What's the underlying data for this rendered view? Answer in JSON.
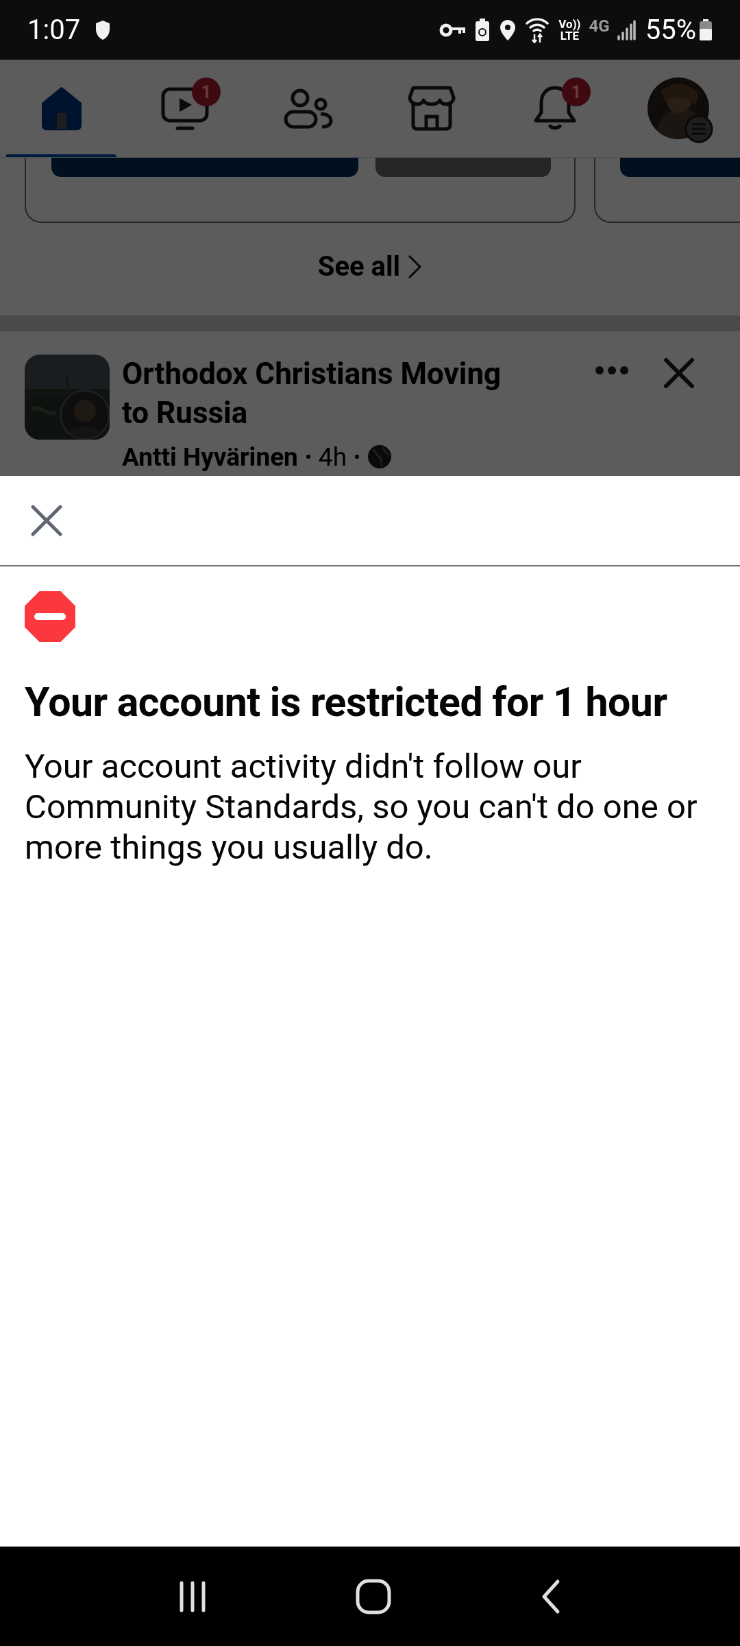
{
  "status_bar": {
    "time": "1:07",
    "volte": [
      "Vo))",
      "LTE"
    ],
    "network": "4G",
    "battery": "55%"
  },
  "tabs": [
    {
      "kind": "home",
      "selected": true
    },
    {
      "kind": "video",
      "selected": false,
      "badge": "1"
    },
    {
      "kind": "friends",
      "selected": false
    },
    {
      "kind": "marketplace",
      "selected": false
    },
    {
      "kind": "notifications",
      "selected": false,
      "badge": "1"
    },
    {
      "kind": "profile",
      "selected": false
    }
  ],
  "feed": {
    "see_all": "See all",
    "post": {
      "group": "Orthodox Christians Moving to Russia",
      "author": "Antti Hyvärinen",
      "time": "4h"
    }
  },
  "dialog": {
    "title": "Your account is restricted for 1 hour",
    "body": "Your account activity didn't follow our Community Standards, so you can't do one or more things you usually do."
  }
}
